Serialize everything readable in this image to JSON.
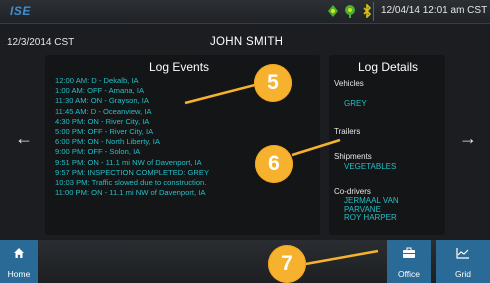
{
  "topbar": {
    "logo": "ISE",
    "datetime": "12/04/14 12:01 am CST",
    "icons": [
      "gps-icon",
      "connection-icon",
      "bluetooth-icon"
    ]
  },
  "header": {
    "date": "12/3/2014 CST",
    "driver": "JOHN SMITH"
  },
  "log_events": {
    "title": "Log Events",
    "items": [
      "12:00 AM: D - Dekalb, IA",
      "1:00 AM: OFF - Amana, IA",
      "11:30 AM: ON - Grayson, IA",
      "11:45 AM: D - Oceanview, IA",
      "4:30 PM: ON - River City, IA",
      "5:00 PM: OFF - River City, IA",
      "6:00 PM: ON - North Liberty, IA",
      "9:00 PM: OFF - Solon, IA",
      "9:51 PM: ON - 11.1 mi NW of Davenport, IA",
      "9:57 PM: INSPECTION COMPLETED: GREY",
      "10:03 PM: Traffic slowed due to construction.",
      "11:00 PM: ON - 11.1 mi NW of Davenport, IA"
    ]
  },
  "log_details": {
    "title": "Log Details",
    "vehicles_label": "Vehicles",
    "vehicles_value": "GREY",
    "trailers_label": "Trailers",
    "shipments_label": "Shipments",
    "shipments_value": "VEGETABLES",
    "codrivers_label": "Co-drivers",
    "codrivers": [
      "JERMAAL VAN",
      "PARVANE",
      "ROY HARPER"
    ]
  },
  "nav": {
    "prev_arrow": "←",
    "next_arrow": "→",
    "home_label": "Home",
    "office_label": "Office",
    "grid_label": "Grid"
  },
  "callouts": {
    "one": "5",
    "two": "6",
    "three": "7",
    "color": "#f6b22f"
  },
  "colors": {
    "accent_text": "#25bfc7",
    "button_blue": "#2a6a96",
    "status_green": "#4caf32",
    "status_yellow": "#d6c21a"
  }
}
